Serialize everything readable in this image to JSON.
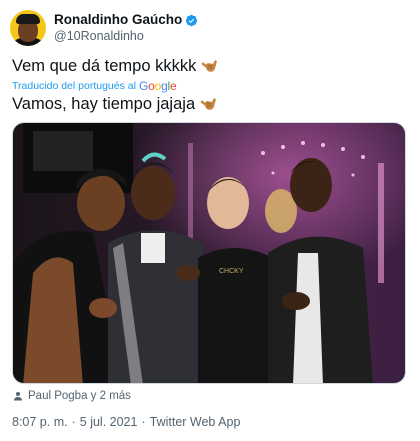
{
  "author": {
    "display_name": "Ronaldinho Gaúcho",
    "handle": "@10Ronaldinho",
    "verified_icon": "verified-badge-icon",
    "avatar_icon": "profile-avatar"
  },
  "tweet": {
    "original_text": "Vem que dá tempo kkkkk",
    "translated_label": "Traducido del portugués al",
    "translator_brand": [
      "G",
      "o",
      "o",
      "g",
      "l",
      "e"
    ],
    "translated_text": "Vamos, hay tiempo jajaja",
    "emoji": "call-me-hand-emoji"
  },
  "media": {
    "alt_icon": "photo-four-men"
  },
  "tags": {
    "icon": "person-icon",
    "text": "Paul Pogba y 2 más"
  },
  "meta": {
    "time": "8:07 p. m.",
    "separator": "·",
    "date": "5 jul. 2021",
    "source": "Twitter Web App"
  },
  "colors": {
    "accent": "#1d9bf0",
    "text": "#0f1419",
    "secondary": "#536471"
  }
}
